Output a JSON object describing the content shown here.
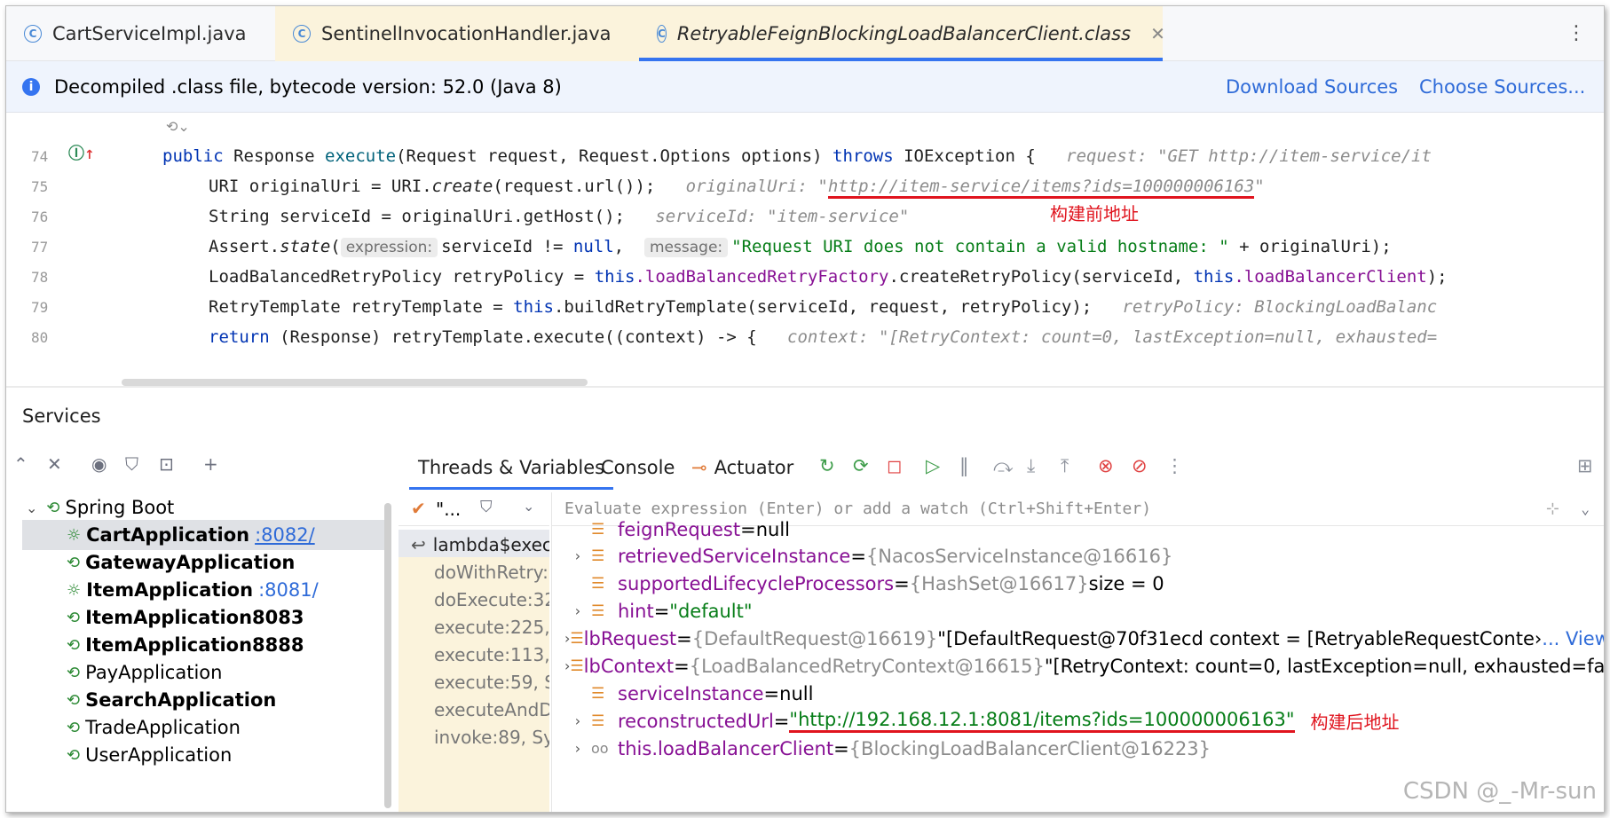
{
  "tabs": [
    {
      "label": "CartServiceImpl.java"
    },
    {
      "label": "SentinelInvocationHandler.java"
    },
    {
      "label": "RetryableFeignBlockingLoadBalancerClient.class"
    }
  ],
  "banner": {
    "text": "Decompiled .class file, bytecode version: 52.0 (Java 8)",
    "download_sources": "Download Sources",
    "choose_sources": "Choose Sources..."
  },
  "editor": {
    "line_numbers": [
      "74",
      "75",
      "76",
      "77",
      "78",
      "79",
      "80"
    ],
    "lines": {
      "l74": {
        "public": "public",
        "type1": " Response ",
        "method": "execute",
        "params": "(Request request, Request.Options options) ",
        "throws": "throws",
        "rest": " IOException {",
        "hint": "request: \"GET http://item-service/it"
      },
      "l75": {
        "pre": "URI originalUri = URI.",
        "create": "create",
        "post": "(request.url());",
        "hint_label": "originalUri: \"",
        "hint_url": "http://item-service/items?ids=100000006163",
        "hint_end": "\""
      },
      "l76": {
        "code": "String serviceId = originalUri.getHost();",
        "hint": "serviceId: \"item-service\""
      },
      "l77": {
        "pre": "Assert.",
        "state": "state",
        "paren": "(",
        "inlay1": "expression:",
        "mid": "serviceId != ",
        "null": "null",
        "comma": ", ",
        "inlay2": "message:",
        "str": "\"Request URI does not contain a valid hostname: \"",
        "end": " + originalUri);"
      },
      "l78": {
        "pre": "LoadBalancedRetryPolicy retryPolicy = ",
        "this1": "this",
        "f1": ".loadBalancedRetryFactory",
        "mid": ".createRetryPolicy(serviceId, ",
        "this2": "this",
        "f2": ".loadBalancerClient",
        "end": ");"
      },
      "l79": {
        "pre": "RetryTemplate retryTemplate = ",
        "this": "this",
        "post": ".buildRetryTemplate(serviceId, request, retryPolicy);",
        "hint": "retryPolicy: BlockingLoadBalanc"
      },
      "l80": {
        "return": "return",
        "post": " (Response) retryTemplate.execute((context) -> {",
        "hint": "context: \"[RetryContext: count=0, lastException=null, exhausted="
      }
    },
    "annotation": "构建前地址"
  },
  "services": {
    "title": "Services",
    "root": "Spring Boot",
    "apps": [
      {
        "name": "CartApplication",
        "port": ":8082/"
      },
      {
        "name": "GatewayApplication",
        "port": ""
      },
      {
        "name": "ItemApplication",
        "port": ":8081/"
      },
      {
        "name": "ItemApplication8083",
        "port": ""
      },
      {
        "name": "ItemApplication8888",
        "port": ""
      },
      {
        "name": "PayApplication",
        "port": ""
      },
      {
        "name": "SearchApplication",
        "port": ""
      },
      {
        "name": "TradeApplication",
        "port": ""
      },
      {
        "name": "UserApplication",
        "port": ""
      }
    ]
  },
  "debugger": {
    "tabs": {
      "threads": "Threads & Variables",
      "console": "Console",
      "actuator": "Actuator"
    },
    "thread_label": "\"...",
    "eval_placeholder": "Evaluate expression (Enter) or add a watch (Ctrl+Shift+Enter)",
    "frames": [
      "lambda$exec",
      "doWithRetry:",
      "doExecute:32",
      "execute:225,",
      "execute:113,",
      "execute:59, S",
      "executeAndD",
      "invoke:89, Sy"
    ],
    "vars": [
      {
        "name": "feignRequest",
        "eq": " = ",
        "val": "null"
      },
      {
        "name": "retrievedServiceInstance",
        "eq": " = ",
        "val": "{NacosServiceInstance@16616}"
      },
      {
        "name": "supportedLifecycleProcessors",
        "eq": " = ",
        "val": "{HashSet@16617}",
        "extra": "  size = 0"
      },
      {
        "name": "hint",
        "eq": " = ",
        "val": "\"default\""
      },
      {
        "name": "lbRequest",
        "eq": " = ",
        "val": "{DefaultRequest@16619}",
        "extra": " \"[DefaultRequest@70f31ecd context = [RetryableRequestConte›",
        "link": "... View"
      },
      {
        "name": "lbContext",
        "eq": " = ",
        "val": "{LoadBalancedRetryContext@16615}",
        "extra": " \"[RetryContext: count=0, lastException=null, exhausted=fal"
      },
      {
        "name": "serviceInstance",
        "eq": " = ",
        "val": "null"
      },
      {
        "name": "reconstructedUrl",
        "eq": " = ",
        "val": "\"http://192.168.12.1:8081/items?ids=100000006163\""
      },
      {
        "name": "this.loadBalancerClient",
        "eq": " = ",
        "val": "{BlockingLoadBalancerClient@16223}"
      }
    ],
    "annotation": "构建后地址"
  },
  "watermark": "CSDN @_-Mr-sun",
  "colors": {
    "accent": "#3574f0",
    "annotation_red": "#e0141e",
    "keyword": "#0033b3",
    "field": "#871094",
    "string": "#067d17"
  }
}
